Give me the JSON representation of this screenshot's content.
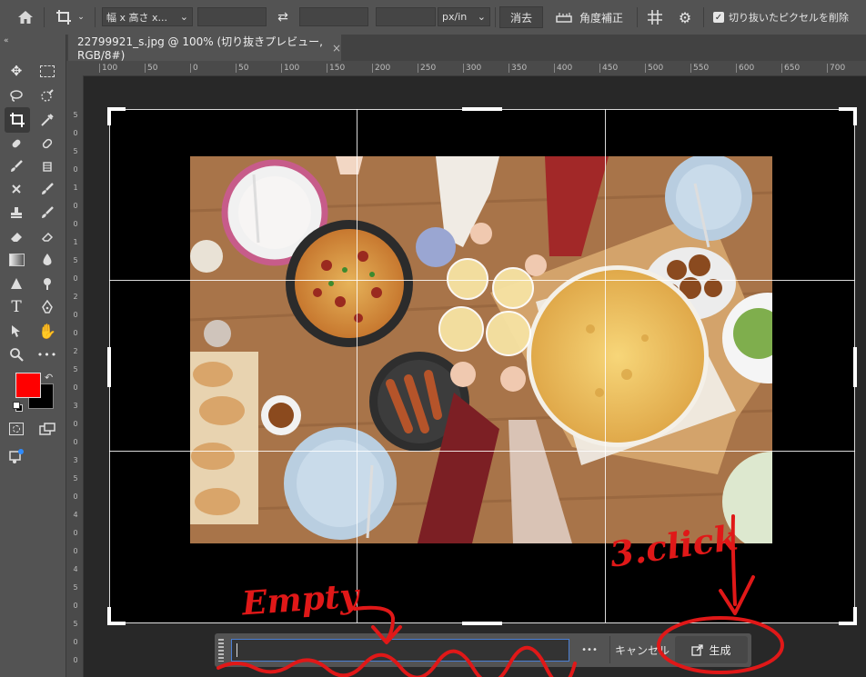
{
  "options_bar": {
    "ratio_select": "幅 x 高さ x...",
    "unit_select": "px/in",
    "clear_button": "消去",
    "straighten_label": "角度補正",
    "delete_cropped_label": "切り抜いたピクセルを削除",
    "delete_cropped_checked": true
  },
  "document": {
    "tab_title": "22799921_s.jpg @ 100% (切り抜きプレビュー, RGB/8#)",
    "close_glyph": "×"
  },
  "ruler": {
    "h_labels": [
      "100",
      "50",
      "0",
      "50",
      "100",
      "150",
      "200",
      "250",
      "300",
      "350",
      "400",
      "450",
      "500",
      "550",
      "600",
      "650",
      "700"
    ],
    "v_labels": [
      "5",
      "0",
      "5",
      "0",
      "1",
      "0",
      "0",
      "1",
      "5",
      "0",
      "2",
      "0",
      "0",
      "2",
      "5",
      "0",
      "3",
      "0",
      "0",
      "3",
      "5",
      "0",
      "4",
      "0",
      "0",
      "4",
      "5",
      "0",
      "5",
      "0",
      "0"
    ]
  },
  "gen_bar": {
    "prompt_value": "",
    "more_glyph": "•••",
    "cancel_label": "キャンセル",
    "generate_label": "生成"
  },
  "annotations": {
    "empty_label": "Empty",
    "step_label": "3.click"
  },
  "colors": {
    "foreground": "#ff0000",
    "background": "#000000",
    "annotation": "#e01818"
  }
}
